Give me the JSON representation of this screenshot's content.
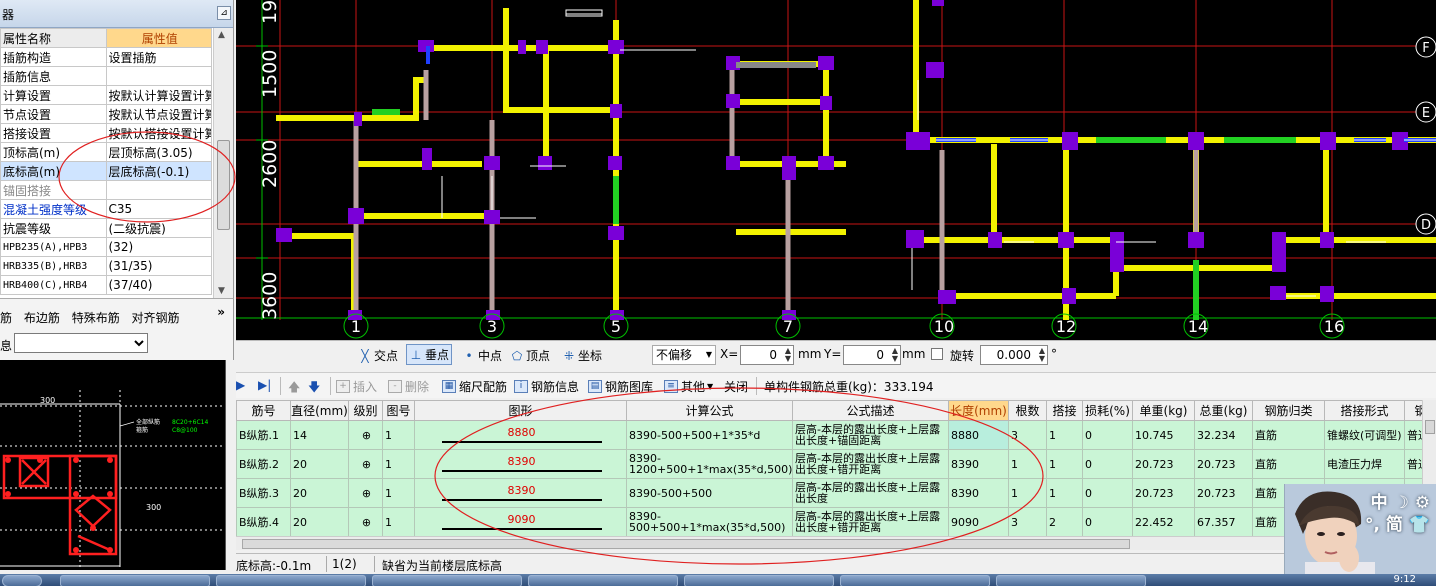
{
  "prop_panel": {
    "title": "器",
    "header": {
      "name": "属性名称",
      "value": "属性值"
    },
    "rows": [
      {
        "name": "插筋构造",
        "value": "设置插筋"
      },
      {
        "name": "插筋信息",
        "value": ""
      },
      {
        "name": "计算设置",
        "value": "按默认计算设置计算"
      },
      {
        "name": "节点设置",
        "value": "按默认节点设置计算"
      },
      {
        "name": "搭接设置",
        "value": "按默认搭接设置计算"
      },
      {
        "name": "顶标高(m)",
        "value": "层顶标高(3.05)"
      },
      {
        "name": "底标高(m)",
        "value": "层底标高(-0.1)"
      },
      {
        "name": "锚固搭接",
        "value": ""
      },
      {
        "name": "混凝土强度等级",
        "value": "C35"
      },
      {
        "name": "抗震等级",
        "value": "(二级抗震)"
      },
      {
        "name": "HPB235(A),HPB3",
        "value": "(32)"
      },
      {
        "name": "HRB335(B),HRB3",
        "value": "(31/35)"
      },
      {
        "name": "HRB400(C),HRB4",
        "value": "(37/40)"
      }
    ]
  },
  "left_toolbar": {
    "items": [
      "筋",
      "布边筋",
      "特殊布筋",
      "对齐钢筋"
    ],
    "more": "»",
    "info_label": "息",
    "info_value": ""
  },
  "preview": {
    "dim_top": "300",
    "dim_right": "300",
    "dim_b1": "450",
    "dim_b2": "300",
    "note1": "全部纵筋",
    "note2": "箍筋",
    "spec1": "8C20+6C14",
    "spec2": "C8@100"
  },
  "canvas": {
    "dim_labels": [
      "1900",
      "1500",
      "2600",
      "3600"
    ],
    "axis_letters": [
      "F",
      "E",
      "D"
    ],
    "axis_numbers": [
      "1",
      "3",
      "5",
      "7",
      "10",
      "12",
      "14",
      "16"
    ]
  },
  "snap_bar": {
    "intersection": "交点",
    "perpendicular": "垂点",
    "midpoint": "中点",
    "vertex": "顶点",
    "coordinate": "坐标",
    "offset_mode": "不偏移",
    "x_label": "X=",
    "x_value": "0",
    "mm1": "mm",
    "y_label": "Y=",
    "y_value": "0",
    "mm2": "mm",
    "rotate_label": "旋转",
    "rotate_value": "0.000",
    "degree": "°"
  },
  "rebar_toolbar": {
    "insert": "插入",
    "delete": "删除",
    "scale": "缩尺配筋",
    "info": "钢筋信息",
    "library": "钢筋图库",
    "other": "其他",
    "close": "关闭",
    "total_weight": "单构件钢筋总重(kg)：333.194"
  },
  "rebar_table": {
    "columns": [
      "筋号",
      "直径(mm)",
      "级别",
      "图号",
      "图形",
      "计算公式",
      "公式描述",
      "长度(mm)",
      "根数",
      "搭接",
      "损耗(%)",
      "单重(kg)",
      "总重(kg)",
      "钢筋归类",
      "搭接形式",
      "钢"
    ],
    "rows": [
      {
        "name": "B纵筋.1",
        "dia": "14",
        "grade": "⊕",
        "fig": "1",
        "shape_value": "8880",
        "formula": "8390-500+500+1*35*d",
        "desc": "层高-本层的露出长度+上层露出长度+锚固距离",
        "length": "8880",
        "count": "3",
        "lap": "1",
        "loss": "0",
        "unit_weight": "10.745",
        "total_weight": "32.234",
        "category": "直筋",
        "lap_type": "锥螺纹(可调型)",
        "steel": "普通"
      },
      {
        "name": "B纵筋.2",
        "dia": "20",
        "grade": "⊕",
        "fig": "1",
        "shape_value": "8390",
        "formula": "8390-1200+500+1*max(35*d,500)",
        "desc": "层高-本层的露出长度+上层露出长度+错开距离",
        "length": "8390",
        "count": "1",
        "lap": "1",
        "loss": "0",
        "unit_weight": "20.723",
        "total_weight": "20.723",
        "category": "直筋",
        "lap_type": "电渣压力焊",
        "steel": "普通"
      },
      {
        "name": "B纵筋.3",
        "dia": "20",
        "grade": "⊕",
        "fig": "1",
        "shape_value": "8390",
        "formula": "8390-500+500",
        "desc": "层高-本层的露出长度+上层露出长度",
        "length": "8390",
        "count": "1",
        "lap": "1",
        "loss": "0",
        "unit_weight": "20.723",
        "total_weight": "20.723",
        "category": "直筋",
        "lap_type": "",
        "steel": ""
      },
      {
        "name": "B纵筋.4",
        "dia": "20",
        "grade": "⊕",
        "fig": "1",
        "shape_value": "9090",
        "formula": "8390-500+500+1*max(35*d,500)",
        "desc": "层高-本层的露出长度+上层露出长度+错开距离",
        "length": "9090",
        "count": "3",
        "lap": "2",
        "loss": "0",
        "unit_weight": "22.452",
        "total_weight": "67.357",
        "category": "直筋",
        "lap_type": "",
        "steel": ""
      }
    ]
  },
  "status_bar": {
    "elevation": "底标高:-0.1m",
    "count": "1(2)",
    "hint": "缺省为当前楼层底标高"
  },
  "taskbar": {
    "clock": "9:12"
  },
  "ime": {
    "line1": "中 ☽ ⚙",
    "line2": "°, 简 👕"
  }
}
